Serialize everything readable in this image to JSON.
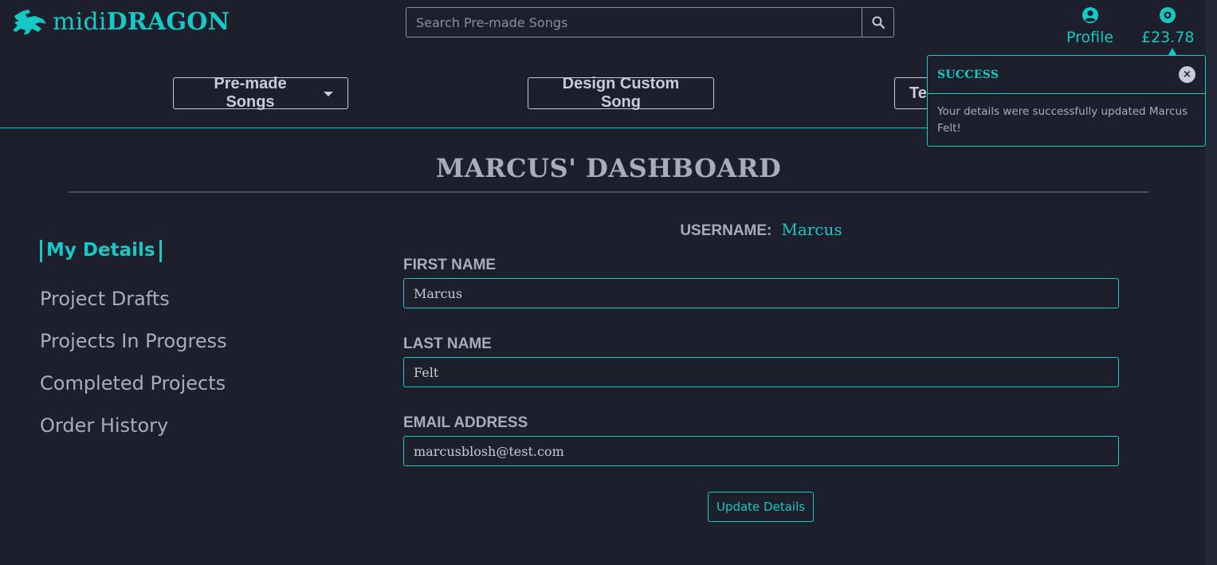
{
  "brand": {
    "name_light": "midi",
    "name_bold": "DRAGON"
  },
  "search": {
    "placeholder": "Search Pre-made Songs",
    "value": ""
  },
  "header_links": {
    "profile": "Profile",
    "credit": "£23.78"
  },
  "nav": {
    "premade": "Pre-made Songs",
    "custom": "Design Custom Song",
    "third": "Te"
  },
  "toast": {
    "title": "SUCCESS",
    "close": "×",
    "message": "Your details were successfully updated Marcus Felt!"
  },
  "page_title": "MARCUS' DASHBOARD",
  "sidebar": {
    "items": [
      {
        "label": "My Details"
      },
      {
        "label": "Project Drafts"
      },
      {
        "label": "Projects In Progress"
      },
      {
        "label": "Completed Projects"
      },
      {
        "label": "Order History"
      }
    ]
  },
  "form": {
    "username_label": "USERNAME:",
    "username_value": "Marcus",
    "first_name_label": "FIRST NAME",
    "first_name_value": "Marcus",
    "last_name_label": "LAST NAME",
    "last_name_value": "Felt",
    "email_label": "EMAIL ADDRESS",
    "email_value": "marcusblosh@test.com",
    "submit_label": "Update Details"
  },
  "colors": {
    "accent": "#17c9c4",
    "background": "#1d202c",
    "text": "#a9acbf"
  },
  "icons": {
    "logo": "dragon-logo-icon",
    "search": "search-icon",
    "profile": "user-circle-icon",
    "credit": "record-disc-icon",
    "close": "close-icon",
    "caret": "caret-down-icon"
  }
}
